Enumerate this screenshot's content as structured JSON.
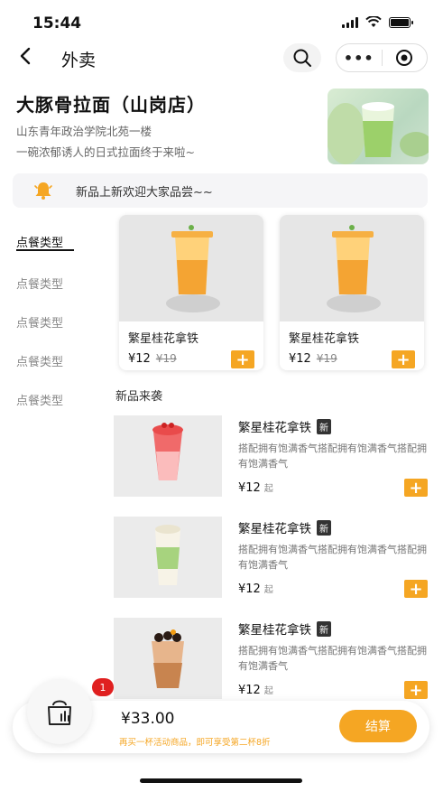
{
  "status": {
    "time": "15:44"
  },
  "nav": {
    "back": "<",
    "title": "外卖",
    "more": "•••"
  },
  "shop": {
    "name": "大豚骨拉面（山岗店）",
    "address": "山东青年政治学院北苑一楼",
    "slogan": "一碗浓郁诱人的日式拉面终于来啦~"
  },
  "notice": {
    "text": "新品上新欢迎大家品尝~~"
  },
  "sidebar": {
    "items": [
      {
        "label": "点餐类型"
      },
      {
        "label": "点餐类型"
      },
      {
        "label": "点餐类型"
      },
      {
        "label": "点餐类型"
      },
      {
        "label": "点餐类型"
      }
    ]
  },
  "featured": [
    {
      "name": "繁星桂花拿铁",
      "price": "¥12",
      "old_price": "¥19"
    },
    {
      "name": "繁星桂花拿铁",
      "price": "¥12",
      "old_price": "¥19"
    }
  ],
  "section_title": "新品来袭",
  "items": [
    {
      "name": "繁星桂花拿铁",
      "badge": "新",
      "desc": "搭配拥有饱满香气搭配拥有饱满香气搭配拥有饱满香气",
      "price": "¥12",
      "unit": "起"
    },
    {
      "name": "繁星桂花拿铁",
      "badge": "新",
      "desc": "搭配拥有饱满香气搭配拥有饱满香气搭配拥有饱满香气",
      "price": "¥12",
      "unit": "起"
    },
    {
      "name": "繁星桂花拿铁",
      "badge": "新",
      "desc": "搭配拥有饱满香气搭配拥有饱满香气搭配拥有饱满香气",
      "price": "¥12",
      "unit": "起"
    }
  ],
  "cart": {
    "badge": "1",
    "total": "¥33.00",
    "promo": "再买一杯活动商品，即可享受第二杯8折",
    "checkout": "结算"
  },
  "colors": {
    "accent": "#f5a623",
    "badge_red": "#e02020"
  }
}
